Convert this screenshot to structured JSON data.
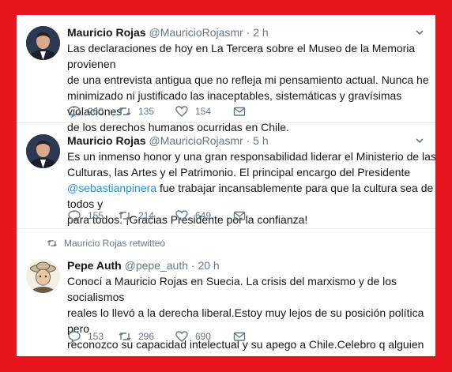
{
  "colors": {
    "background": "#e8141e",
    "link": "#1b95e0",
    "muted": "#657786"
  },
  "tweets": [
    {
      "name": "Mauricio Rojas",
      "handle": "@MauricioRojasmr",
      "dot": "·",
      "time": "2 h",
      "text": "Las declaraciones de hoy en La Tercera sobre el Museo de la Memoria provienen\nde una entrevista antigua que no refleja mi pensamiento actual. Nunca he\nminimizado ni justificado las inaceptables, sistemáticas y gravísimas violaciones\nde los derechos humanos ocurridas en Chile.",
      "replies": "260",
      "retweets": "135",
      "likes": "154"
    },
    {
      "name": "Mauricio Rojas",
      "handle": "@MauricioRojasmr",
      "dot": "·",
      "time": "5 h",
      "text_before": "Es un inmenso honor y una gran responsabilidad liderar el Ministerio de las\nCulturas, las Artes y el Patrimonio. El principal encargo del Presidente\n",
      "mention": "@sebastianpinera",
      "text_after": " fue trabajar incansablemente para que la cultura sea de todos y\npara todos. ¡Gracias Presidente por la confianza!",
      "replies": "155",
      "retweets": "214",
      "likes": "649"
    },
    {
      "retweeted_by": "Mauricio Rojas retwitteó",
      "name": "Pepe Auth",
      "handle": "@pepe_auth",
      "dot": "·",
      "time": "20 h",
      "text": "Conocí a Mauricio Rojas en Suecia. La crisis del marxismo y de los socialismos\nreales lo llevó a la derecha liberal.Estoy muy lejos de su posición política pero\nreconozco su capacidad intelectual y su apego a Chile.Celebro q alguien formado\nen el exilio sueco sea ministro aquí",
      "replies": "153",
      "retweets": "296",
      "likes": "690"
    }
  ],
  "icons": {
    "reply": "reply-icon",
    "retweet": "retweet-icon",
    "like": "heart-icon",
    "dm": "envelope-icon",
    "caret": "chevron-down-icon"
  }
}
